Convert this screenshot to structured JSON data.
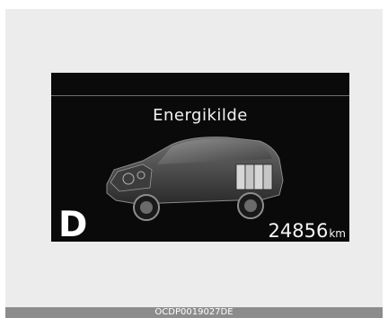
{
  "screen": {
    "title": "Energikilde",
    "gear": "D",
    "odometer_value": "24856",
    "odometer_unit": "km"
  },
  "figure_code": "OCDP0019027DE",
  "colors": {
    "screen_background": "#0a0a0a",
    "panel_background": "#ececec",
    "code_bar": "#8c8c8c",
    "text": "#ffffff"
  },
  "icons": {
    "vehicle": "car-energy-flow-icon"
  }
}
